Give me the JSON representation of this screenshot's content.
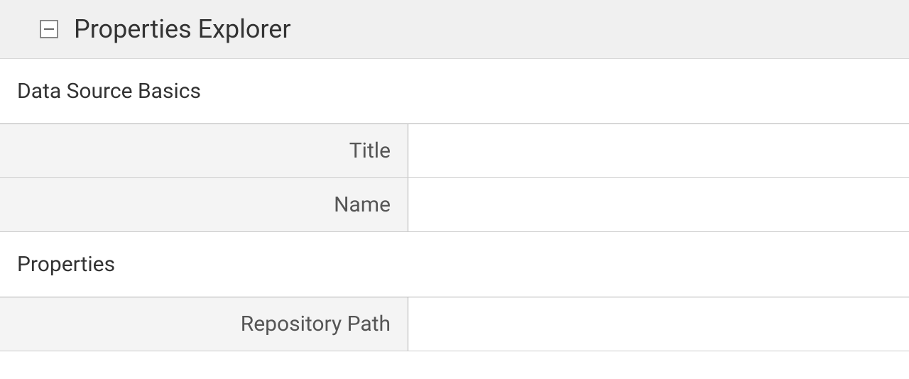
{
  "header": {
    "title": "Properties Explorer"
  },
  "sections": {
    "basics": {
      "heading": "Data Source Basics",
      "rows": {
        "title": {
          "label": "Title",
          "value": ""
        },
        "name": {
          "label": "Name",
          "value": ""
        }
      }
    },
    "properties": {
      "heading": "Properties",
      "rows": {
        "repoPath": {
          "label": "Repository Path",
          "value": ""
        }
      }
    }
  }
}
